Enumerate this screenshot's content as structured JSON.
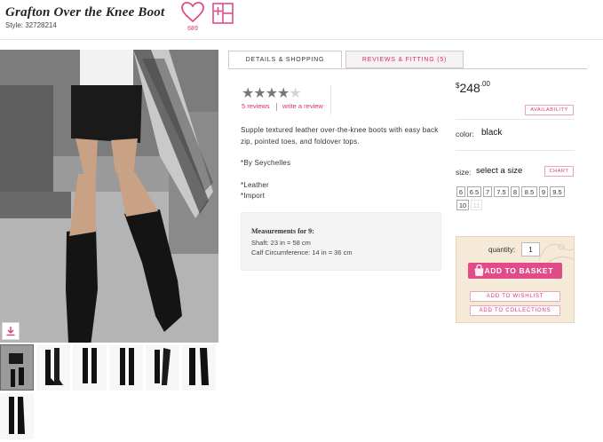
{
  "product": {
    "title": "Grafton Over the Knee Boot",
    "style": "Style: 32728214",
    "likes": "689"
  },
  "tabs": [
    "DETAILS & SHOPPING",
    "REVIEWS & FITTING (5)"
  ],
  "reviews": {
    "stars": "★★★★",
    "star_off": "★",
    "rating": 4,
    "reviews_link": "5 reviews",
    "write_link": "write a review"
  },
  "description": {
    "text": "Supple textured leather over-the-knee boots with easy back zip, pointed toes, and foldover tops.",
    "by": "*By Seychelles",
    "materials": [
      "*Leather",
      "*Import"
    ]
  },
  "measurements": {
    "title": "Measurements for 9:",
    "lines": [
      "Shaft: 23 in = 58 cm",
      "Calf Circumference: 14 in = 36 cm"
    ]
  },
  "price": {
    "currency": "$",
    "whole": "248",
    "cents": ".00"
  },
  "availability_label": "AVAILABILITY",
  "color": {
    "label": "color:",
    "value": "black"
  },
  "size": {
    "label": "size:",
    "value": "select a size",
    "chart_label": "CHART",
    "options": [
      "6",
      "6.5",
      "7",
      "7.5",
      "8",
      "8.5",
      "9",
      "9.5",
      "10",
      "11"
    ],
    "unavailable": [
      "11"
    ]
  },
  "purchase": {
    "quantity_label": "quantity:",
    "quantity_value": "1",
    "add_basket": "ADD TO BASKET",
    "add_wishlist": "ADD TO WISHLIST",
    "add_collections": "ADD TO COLLECTIONS"
  },
  "colors": {
    "accent": "#d6336c",
    "button": "#e14b89",
    "panel": "#f4ead7"
  },
  "icons": [
    "heart-icon",
    "add-to-board-icon",
    "download-icon",
    "shopping-bag-icon"
  ]
}
